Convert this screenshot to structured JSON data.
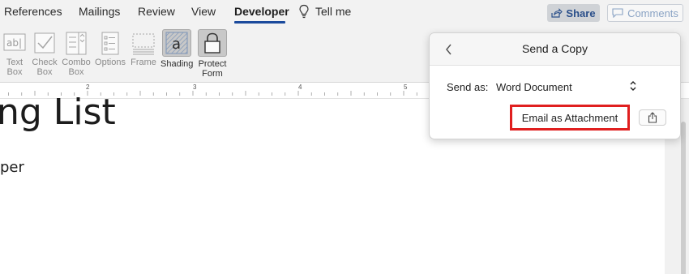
{
  "tabs": [
    {
      "label": "References"
    },
    {
      "label": "Mailings"
    },
    {
      "label": "Review"
    },
    {
      "label": "View"
    },
    {
      "label": "Developer"
    },
    {
      "label": "Tell me"
    }
  ],
  "active_tab": "Developer",
  "share_label": "Share",
  "comments_label": "Comments",
  "ribbon": {
    "text_box": "Text\nBox",
    "check_box": "Check\nBox",
    "combo_box": "Combo\nBox",
    "options": "Options",
    "frame": "Frame",
    "shading": "Shading",
    "protect_form": "Protect\nForm"
  },
  "ruler_numbers": [
    "2",
    "3",
    "4",
    "5"
  ],
  "document": {
    "heading_fragment": "ng List",
    "subtext_fragment": "per"
  },
  "popover": {
    "title": "Send a Copy",
    "send_as_label": "Send as:",
    "send_as_value": "Word Document",
    "email_button": "Email as Attachment"
  },
  "colors": {
    "accent_underline": "#1b4a9c",
    "highlight_border": "#e01f1f",
    "share_text": "#2a4f8a"
  },
  "icons": [
    "lightbulb-icon",
    "share-icon",
    "comment-icon",
    "text-box-icon",
    "check-box-icon",
    "combo-box-icon",
    "options-icon",
    "frame-icon",
    "shading-icon",
    "lock-icon",
    "chevron-left-icon",
    "updown-chevron-icon",
    "export-icon"
  ]
}
